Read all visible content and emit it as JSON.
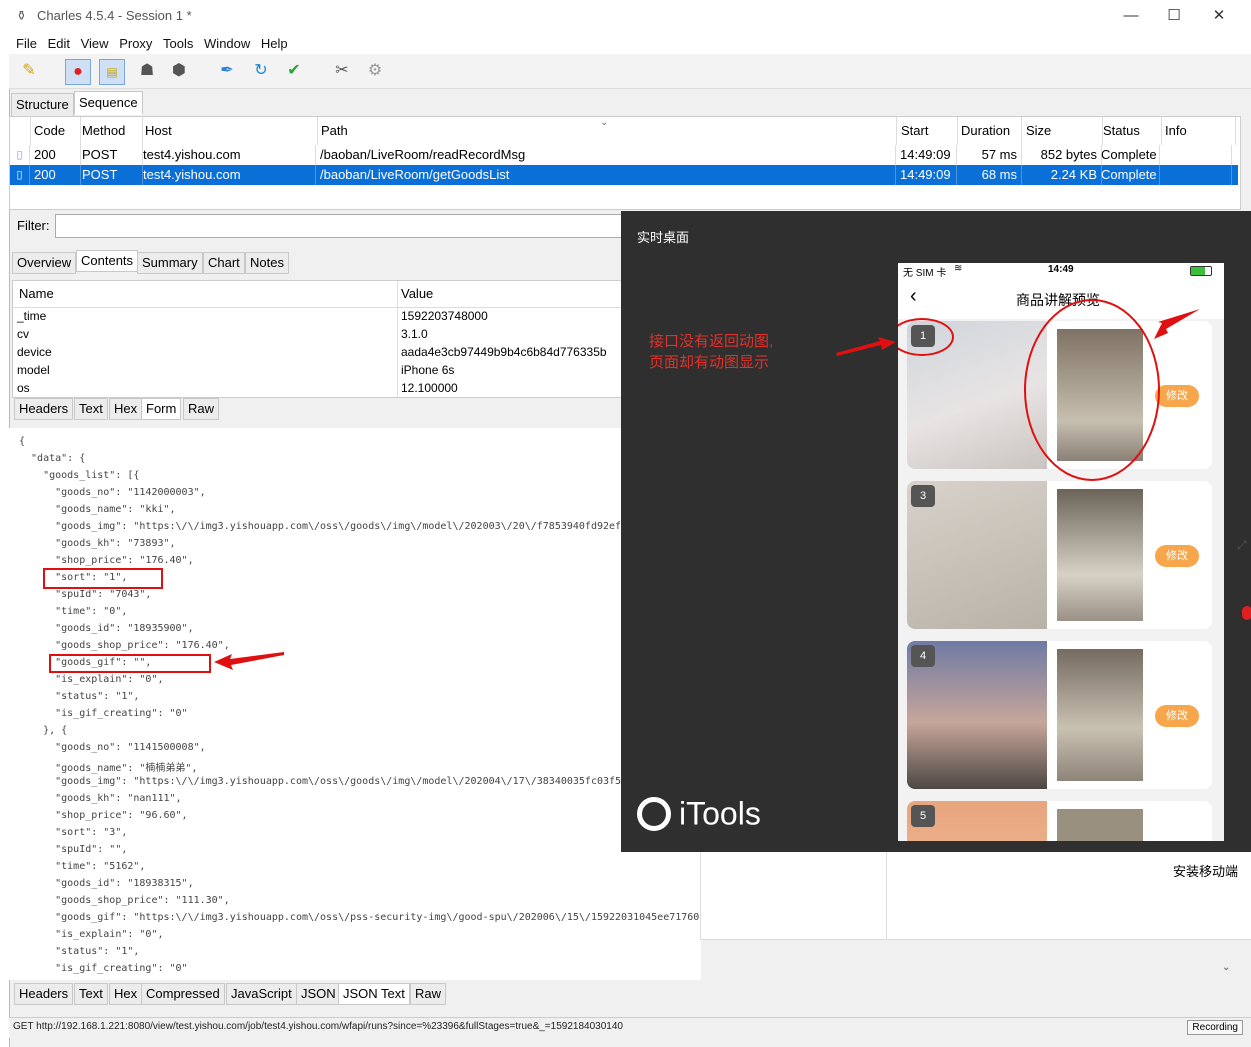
{
  "window": {
    "title": "Charles 4.5.4 - Session 1 *"
  },
  "menu": [
    "File",
    "Edit",
    "View",
    "Proxy",
    "Tools",
    "Window",
    "Help"
  ],
  "view_tabs": [
    "Structure",
    "Sequence"
  ],
  "sequence": {
    "columns": [
      "Code",
      "Method",
      "Host",
      "Path",
      "Start",
      "Duration",
      "Size",
      "Status",
      "Info"
    ],
    "rows": [
      [
        "200",
        "POST",
        "test4.yishou.com",
        "/baoban/LiveRoom/readRecordMsg",
        "14:49:09",
        "57 ms",
        "852 bytes",
        "Complete",
        ""
      ],
      [
        "200",
        "POST",
        "test4.yishou.com",
        "/baoban/LiveRoom/getGoodsList",
        "14:49:09",
        "68 ms",
        "2.24 KB",
        "Complete",
        ""
      ]
    ]
  },
  "filter": {
    "label": "Filter:"
  },
  "detail_tabs": [
    "Overview",
    "Contents",
    "Summary",
    "Chart",
    "Notes"
  ],
  "form_table": {
    "headers": [
      "Name",
      "Value"
    ],
    "rows": [
      [
        "_time",
        "1592203748000"
      ],
      [
        "cv",
        "3.1.0"
      ],
      [
        "device",
        "aada4e3cb97449b9b4c6b84d776335b"
      ],
      [
        "model",
        "iPhone 6s"
      ],
      [
        "os",
        "12.100000"
      ]
    ]
  },
  "request_tabs": [
    "Headers",
    "Text",
    "Hex",
    "Form",
    "Raw"
  ],
  "json_lines": [
    "{",
    "  \"data\": {",
    "    \"goods_list\": [{",
    "      \"goods_no\": \"1142000003\",",
    "      \"goods_name\": \"kki\",",
    "      \"goods_img\": \"https:\\/\\/img3.yishouapp.com\\/oss\\/goods\\/img\\/model\\/202003\\/20\\/f7853940fd92ef6",
    "      \"goods_kh\": \"73893\",",
    "      \"shop_price\": \"176.40\",",
    "      \"sort\": \"1\",",
    "      \"spuId\": \"7043\",",
    "      \"time\": \"0\",",
    "      \"goods_id\": \"18935900\",",
    "      \"goods_shop_price\": \"176.40\",",
    "      \"goods_gif\": \"\",",
    "      \"is_explain\": \"0\",",
    "      \"status\": \"1\",",
    "      \"is_gif_creating\": \"0\"",
    "    }, {",
    "      \"goods_no\": \"1141500008\",",
    "      \"goods_name\": \"楠楠弟弟\",",
    "      \"goods_img\": \"https:\\/\\/img3.yishouapp.com\\/oss\\/goods\\/img\\/model\\/202004\\/17\\/38340035fc03f5",
    "      \"goods_kh\": \"nan111\",",
    "      \"shop_price\": \"96.60\",",
    "      \"sort\": \"3\",",
    "      \"spuId\": \"\",",
    "      \"time\": \"5162\",",
    "      \"goods_id\": \"18938315\",",
    "      \"goods_shop_price\": \"111.30\",",
    "      \"goods_gif\": \"https:\\/\\/img3.yishouapp.com\\/oss\\/pss-security-img\\/good-spu\\/202006\\/15\\/15922031045ee717606",
    "      \"is_explain\": \"0\",",
    "      \"status\": \"1\",",
    "      \"is_gif_creating\": \"0\""
  ],
  "response_tabs": [
    "Headers",
    "Text",
    "Hex",
    "Compressed",
    "JavaScript",
    "JSON",
    "JSON Text",
    "Raw"
  ],
  "status_bar": {
    "url": "GET http://192.168.1.221:8080/view/test.yishou.com/job/test4.yishou.com/wfapi/runs?since=%23396&fullStages=true&_=1592184030140",
    "recording": "Recording"
  },
  "background_window": {
    "label": "安装移动端"
  },
  "itools": {
    "header": "实时桌面",
    "brand": "iTools",
    "annotation": [
      "接口没有返回动图,",
      "页面却有动图显示"
    ],
    "phone": {
      "carrier": "无 SIM 卡",
      "time": "14:49",
      "page_title": "商品讲解预览",
      "edit_label": "修改",
      "items": [
        "1",
        "3",
        "4",
        "5"
      ]
    }
  },
  "colors": {
    "selection": "#0a6fd6",
    "annotation_red": "#e01010",
    "edit_orange": "#f7a64b"
  }
}
